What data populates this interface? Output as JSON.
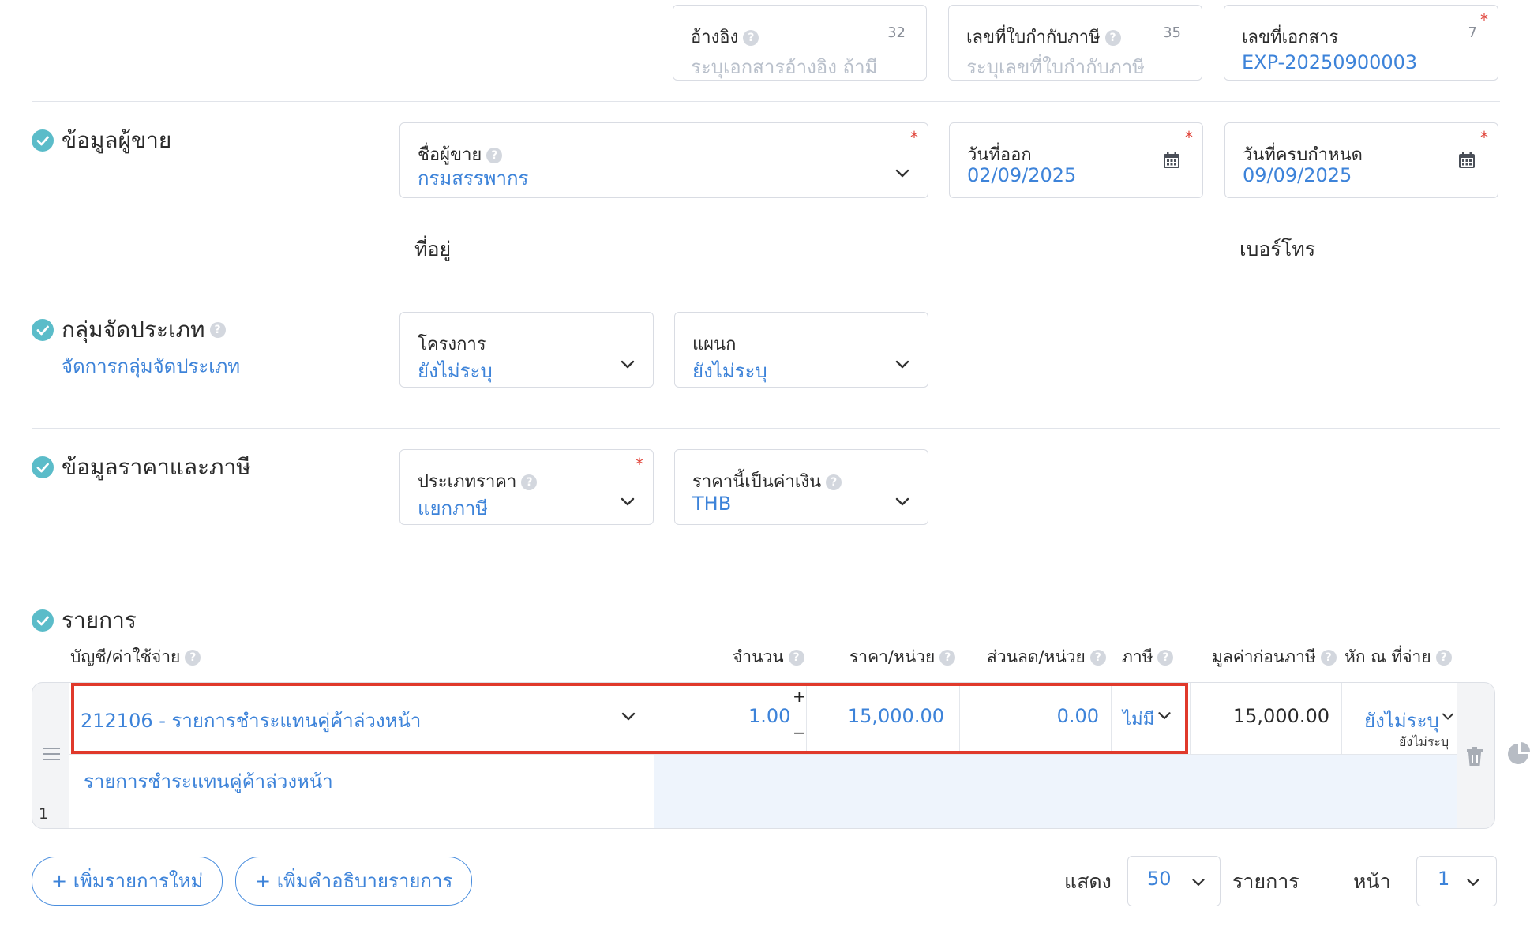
{
  "top_fields": {
    "reference": {
      "label": "อ้างอิง",
      "placeholder": "ระบุเอกสารอ้างอิง ถ้ามี",
      "count": "32"
    },
    "tax_invoice_no": {
      "label": "เลขที่ใบกำกับภาษี",
      "placeholder": "ระบุเลขที่ใบกำกับภาษี",
      "count": "35"
    },
    "document_no": {
      "label": "เลขที่เอกสาร",
      "value": "EXP-20250900003",
      "count": "7"
    }
  },
  "vendor_section": {
    "title": "ข้อมูลผู้ขาย",
    "vendor_name": {
      "label": "ชื่อผู้ขาย",
      "value": "กรมสรรพากร"
    },
    "issue_date": {
      "label": "วันที่ออก",
      "value": "02/09/2025"
    },
    "due_date": {
      "label": "วันที่ครบกำหนด",
      "value": "09/09/2025"
    },
    "address_label": "ที่อยู่",
    "phone_label": "เบอร์โทร"
  },
  "group_section": {
    "title": "กลุ่มจัดประเภท",
    "manage_link": "จัดการกลุ่มจัดประเภท",
    "project": {
      "label": "โครงการ",
      "value": "ยังไม่ระบุ"
    },
    "department": {
      "label": "แผนก",
      "value": "ยังไม่ระบุ"
    }
  },
  "price_section": {
    "title": "ข้อมูลราคาและภาษี",
    "price_type": {
      "label": "ประเภทราคา",
      "value": "แยกภาษี"
    },
    "currency": {
      "label": "ราคานี้เป็นค่าเงิน",
      "value": "THB"
    }
  },
  "items_section": {
    "title": "รายการ",
    "columns": {
      "account": "บัญชี/ค่าใช้จ่าย",
      "qty": "จำนวน",
      "unit_price": "ราคา/หน่วย",
      "discount": "ส่วนลด/หน่วย",
      "tax": "ภาษี",
      "pre_tax": "มูลค่าก่อนภาษี",
      "wht": "หัก ณ ที่จ่าย"
    },
    "rows": [
      {
        "account": "212106 - รายการชำระแทนคู่ค้าล่วงหน้า",
        "description": "รายการชำระแทนคู่ค้าล่วงหน้า",
        "qty": "1.00",
        "unit_price": "15,000.00",
        "discount": "0.00",
        "tax": "ไม่มี",
        "pre_tax": "15,000.00",
        "wht": "ยังไม่ระบุ",
        "wht_sub": "ยังไม่ระบุ",
        "index": "1"
      }
    ],
    "qty_plus": "+",
    "qty_minus": "−"
  },
  "footer": {
    "add_item": "+ เพิ่มรายการใหม่",
    "add_description": "+ เพิ่มคำอธิบายรายการ",
    "show_label": "แสดง",
    "page_size": "50",
    "items_label": "รายการ",
    "page_label": "หน้า",
    "page_number": "1"
  },
  "colors": {
    "accent": "#3d83d9",
    "check": "#5bbcc9",
    "highlight": "#e0392b",
    "required": "#e0443a"
  }
}
